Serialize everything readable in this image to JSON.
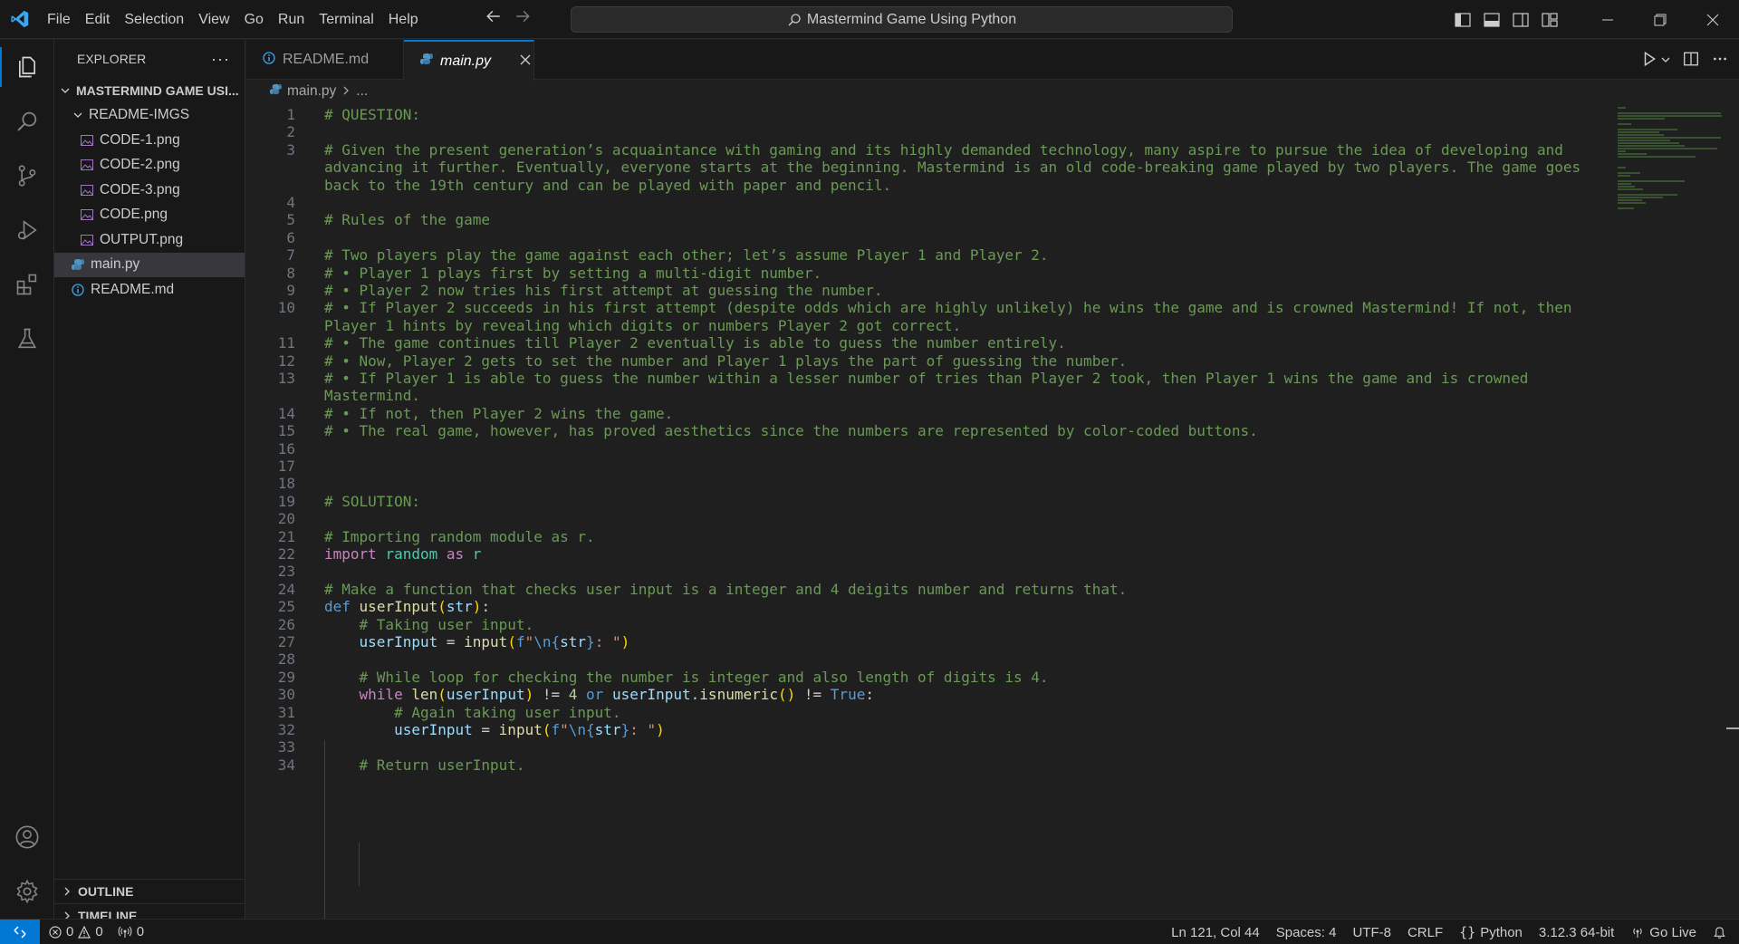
{
  "menu": [
    "File",
    "Edit",
    "Selection",
    "View",
    "Go",
    "Run",
    "Terminal",
    "Help"
  ],
  "command_center": "Mastermind Game Using Python",
  "sidebar": {
    "title": "EXPLORER",
    "more": "···",
    "root": "MASTERMIND GAME USI...",
    "folder": "README-IMGS",
    "folder_files": [
      "CODE-1.png",
      "CODE-2.png",
      "CODE-3.png",
      "CODE.png",
      "OUTPUT.png"
    ],
    "files": [
      "main.py",
      "README.md"
    ],
    "outline": "OUTLINE",
    "timeline": "TIMELINE"
  },
  "tabs": [
    {
      "label": "README.md"
    },
    {
      "label": "main.py"
    }
  ],
  "breadcrumb": {
    "file": "main.py",
    "trail": "..."
  },
  "code": [
    {
      "n": "1",
      "t": [
        [
          "c-com",
          "# QUESTION:"
        ]
      ]
    },
    {
      "n": "2",
      "t": []
    },
    {
      "n": "3",
      "t": [
        [
          "c-com",
          "# Given the present generation’s acquaintance with gaming and its highly demanded technology, many aspire to pursue the idea of developing and"
        ]
      ]
    },
    {
      "n": "",
      "t": [
        [
          "c-com",
          "advancing it further. Eventually, everyone starts at the beginning. Mastermind is an old code-breaking game played by two players. The game goes"
        ]
      ]
    },
    {
      "n": "",
      "t": [
        [
          "c-com",
          "back to the 19th century and can be played with paper and pencil."
        ]
      ]
    },
    {
      "n": "4",
      "t": []
    },
    {
      "n": "5",
      "t": [
        [
          "c-com",
          "# Rules of the game"
        ]
      ]
    },
    {
      "n": "6",
      "t": []
    },
    {
      "n": "7",
      "t": [
        [
          "c-com",
          "# Two players play the game against each other; let’s assume Player 1 and Player 2."
        ]
      ]
    },
    {
      "n": "8",
      "t": [
        [
          "c-com",
          "# • Player 1 plays first by setting a multi-digit number."
        ]
      ]
    },
    {
      "n": "9",
      "t": [
        [
          "c-com",
          "# • Player 2 now tries his first attempt at guessing the number."
        ]
      ]
    },
    {
      "n": "10",
      "t": [
        [
          "c-com",
          "# • If Player 2 succeeds in his first attempt (despite odds which are highly unlikely) he wins the game and is crowned Mastermind! If not, then"
        ]
      ]
    },
    {
      "n": "",
      "t": [
        [
          "c-com",
          "Player 1 hints by revealing which digits or numbers Player 2 got correct."
        ]
      ]
    },
    {
      "n": "11",
      "t": [
        [
          "c-com",
          "# • The game continues till Player 2 eventually is able to guess the number entirely."
        ]
      ]
    },
    {
      "n": "12",
      "t": [
        [
          "c-com",
          "# • Now, Player 2 gets to set the number and Player 1 plays the part of guessing the number."
        ]
      ]
    },
    {
      "n": "13",
      "t": [
        [
          "c-com",
          "# • If Player 1 is able to guess the number within a lesser number of tries than Player 2 took, then Player 1 wins the game and is crowned"
        ]
      ]
    },
    {
      "n": "",
      "t": [
        [
          "c-com",
          "Mastermind."
        ]
      ]
    },
    {
      "n": "14",
      "t": [
        [
          "c-com",
          "# • If not, then Player 2 wins the game."
        ]
      ]
    },
    {
      "n": "15",
      "t": [
        [
          "c-com",
          "# • The real game, however, has proved aesthetics since the numbers are represented by color-coded buttons."
        ]
      ]
    },
    {
      "n": "16",
      "t": []
    },
    {
      "n": "17",
      "t": []
    },
    {
      "n": "18",
      "t": []
    },
    {
      "n": "19",
      "t": [
        [
          "c-com",
          "# SOLUTION:"
        ]
      ]
    },
    {
      "n": "20",
      "t": []
    },
    {
      "n": "21",
      "t": [
        [
          "c-com",
          "# Importing random module as r."
        ]
      ]
    },
    {
      "n": "22",
      "t": [
        [
          "c-kw",
          "import"
        ],
        [
          "",
          " "
        ],
        [
          "c-cls",
          "random"
        ],
        [
          "",
          " "
        ],
        [
          "c-kw",
          "as"
        ],
        [
          "",
          " "
        ],
        [
          "c-cls",
          "r"
        ]
      ]
    },
    {
      "n": "23",
      "t": []
    },
    {
      "n": "24",
      "t": [
        [
          "c-com",
          "# Make a function that checks user input is a integer and 4 deigits number and returns that."
        ]
      ]
    },
    {
      "n": "25",
      "t": [
        [
          "c-def",
          "def"
        ],
        [
          "",
          " "
        ],
        [
          "c-fn",
          "userInput"
        ],
        [
          "c-par",
          "("
        ],
        [
          "c-var",
          "str"
        ],
        [
          "c-par",
          ")"
        ],
        [
          "",
          ":"
        ]
      ]
    },
    {
      "n": "26",
      "t": [
        [
          "",
          "    "
        ],
        [
          "c-com",
          "# Taking user input."
        ]
      ]
    },
    {
      "n": "27",
      "t": [
        [
          "",
          "    "
        ],
        [
          "c-var",
          "userInput"
        ],
        [
          "",
          " = "
        ],
        [
          "c-fn",
          "input"
        ],
        [
          "c-par",
          "("
        ],
        [
          "c-def",
          "f"
        ],
        [
          "c-str",
          "\""
        ],
        [
          "c-con",
          "\\n"
        ],
        [
          "c-def",
          "{"
        ],
        [
          "c-var",
          "str"
        ],
        [
          "c-def",
          "}"
        ],
        [
          "c-str",
          ": \""
        ],
        [
          "c-par",
          ")"
        ]
      ]
    },
    {
      "n": "28",
      "t": []
    },
    {
      "n": "29",
      "t": [
        [
          "",
          "    "
        ],
        [
          "c-com",
          "# While loop for checking the number is integer and also length of digits is 4."
        ]
      ]
    },
    {
      "n": "30",
      "t": [
        [
          "",
          "    "
        ],
        [
          "c-kw",
          "while"
        ],
        [
          "",
          " "
        ],
        [
          "c-fn",
          "len"
        ],
        [
          "c-par",
          "("
        ],
        [
          "c-var",
          "userInput"
        ],
        [
          "c-par",
          ")"
        ],
        [
          "",
          " != "
        ],
        [
          "c-num",
          "4"
        ],
        [
          "",
          " "
        ],
        [
          "c-def",
          "or"
        ],
        [
          "",
          " "
        ],
        [
          "c-var",
          "userInput"
        ],
        [
          "",
          "."
        ],
        [
          "c-fn",
          "isnumeric"
        ],
        [
          "c-par",
          "()"
        ],
        [
          "",
          " != "
        ],
        [
          "c-con",
          "True"
        ],
        [
          "",
          ":"
        ]
      ]
    },
    {
      "n": "31",
      "t": [
        [
          "",
          "        "
        ],
        [
          "c-com",
          "# Again taking user input."
        ]
      ]
    },
    {
      "n": "32",
      "t": [
        [
          "",
          "        "
        ],
        [
          "c-var",
          "userInput"
        ],
        [
          "",
          " = "
        ],
        [
          "c-fn",
          "input"
        ],
        [
          "c-par",
          "("
        ],
        [
          "c-def",
          "f"
        ],
        [
          "c-str",
          "\""
        ],
        [
          "c-con",
          "\\n"
        ],
        [
          "c-def",
          "{"
        ],
        [
          "c-var",
          "str"
        ],
        [
          "c-def",
          "}"
        ],
        [
          "c-str",
          ": \""
        ],
        [
          "c-par",
          ")"
        ]
      ]
    },
    {
      "n": "33",
      "t": []
    },
    {
      "n": "34",
      "t": [
        [
          "",
          "    "
        ],
        [
          "c-com",
          "# Return userInput."
        ]
      ]
    }
  ],
  "status": {
    "errors": "0",
    "warnings": "0",
    "ports": "0",
    "position": "Ln 121, Col 44",
    "spaces": "Spaces: 4",
    "encoding": "UTF-8",
    "eol": "CRLF",
    "language": "Python",
    "interpreter": "3.12.3 64-bit",
    "golive": "Go Live"
  },
  "colors": {
    "accent": "#0078d4",
    "comment": "#6a9955",
    "keyword": "#c586c0"
  }
}
